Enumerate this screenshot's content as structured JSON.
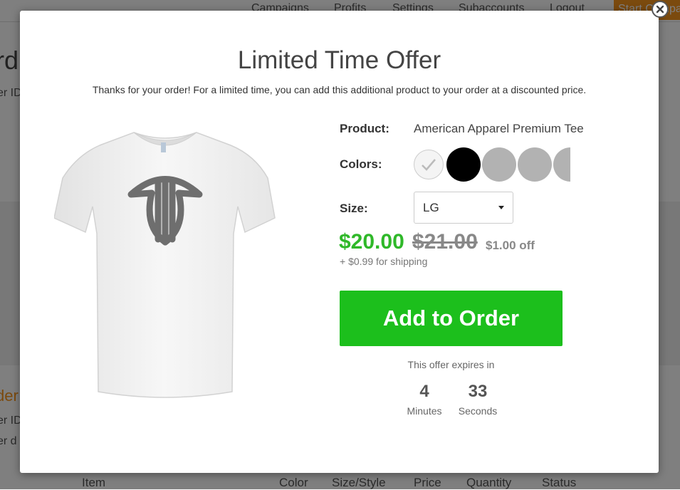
{
  "background": {
    "nav": [
      "Campaigns",
      "Profits",
      "Settings",
      "Subaccounts",
      "Logout"
    ],
    "nav_cta": "Start Campa",
    "heading": "rd",
    "order_id_1": "er ID",
    "section_heading": "der",
    "order_id_2": "er ID",
    "order_date": "er d",
    "table_headers": [
      "Item",
      "Color",
      "Size/Style",
      "Price",
      "Quantity",
      "Status"
    ]
  },
  "modal": {
    "title": "Limited Time Offer",
    "subtitle": "Thanks for your order! For a limited time, you can add this additional product to your order at a discounted price.",
    "product_label": "Product:",
    "product_value": "American Apparel Premium Tee",
    "colors_label": "Colors:",
    "colors": [
      "#f4f4f4",
      "#000000",
      "#b2b2b2",
      "#b2b2b2",
      "#b2b2b2"
    ],
    "selected_color": "white",
    "size_label": "Size:",
    "size_value": "LG",
    "price_new": "$20.00",
    "price_old": "$21.00",
    "price_off": "$1.00 off",
    "shipping": "+ $0.99 for shipping",
    "add_button": "Add to Order",
    "expires_text": "This offer expires in",
    "timer": {
      "minutes": "4",
      "minutes_label": "Minutes",
      "seconds": "33",
      "seconds_label": "Seconds"
    },
    "accent_color": "#1cbf1c",
    "price_color": "#2fb829"
  }
}
